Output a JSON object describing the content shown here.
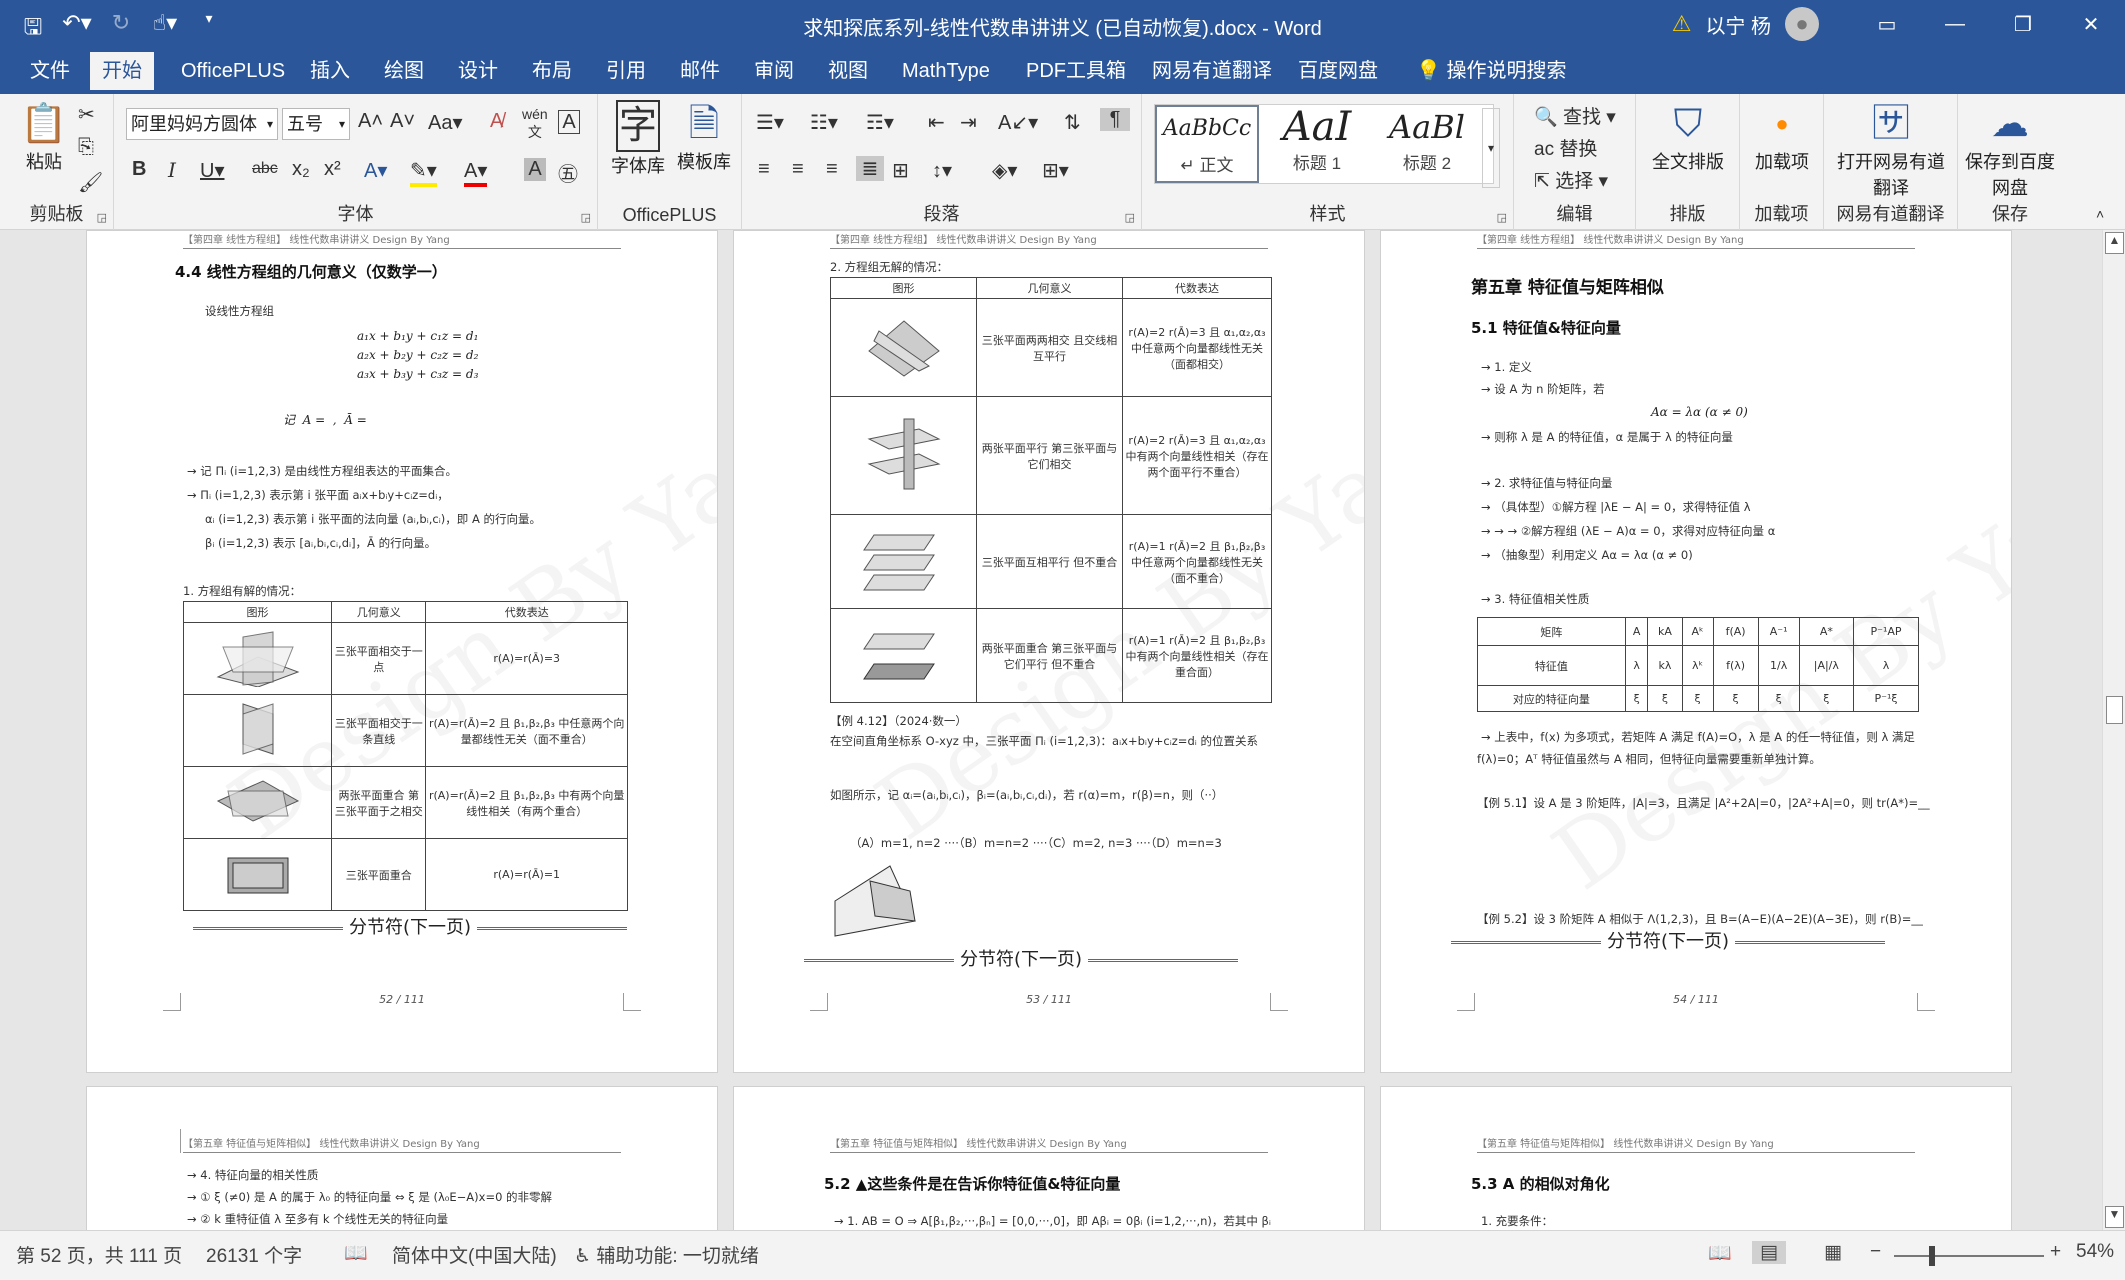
{
  "window": {
    "title": "求知探底系列-线性代数串讲讲义 (已自动恢复).docx  -  Word",
    "user": "以宁 杨"
  },
  "tabs": [
    "文件",
    "开始",
    "OfficePLUS",
    "插入",
    "绘图",
    "设计",
    "布局",
    "引用",
    "邮件",
    "审阅",
    "视图",
    "MathType",
    "PDF工具箱",
    "网易有道翻译",
    "百度网盘",
    "操作说明搜索"
  ],
  "ribbon": {
    "clipboard": {
      "label": "剪贴板",
      "paste": "粘贴"
    },
    "font": {
      "label": "字体",
      "font_name": "阿里妈妈方圆体",
      "font_size": "五号"
    },
    "officeplus": {
      "label": "OfficePLUS",
      "lib": "字体库",
      "template": "模板库"
    },
    "paragraph": {
      "label": "段落"
    },
    "styles": {
      "label": "样式",
      "items": [
        {
          "sample": "AaBbCc",
          "name": "↵ 正文"
        },
        {
          "sample": "AaI",
          "name": "标题 1"
        },
        {
          "sample": "AaBl",
          "name": "标题 2"
        }
      ]
    },
    "edit": {
      "label": "编辑",
      "find": "查找",
      "replace": "替换",
      "select": "选择"
    },
    "layout": {
      "label": "排版",
      "fulltext": "全文排版"
    },
    "addin": {
      "label": "加载项",
      "load": "加载项"
    },
    "youdao": {
      "label": "网易有道翻译",
      "open": "打开网易有道翻译"
    },
    "baidu": {
      "label": "保存",
      "save": "保存到百度网盘"
    }
  },
  "pages": {
    "p52": {
      "heading": "4.4 线性方程组的几何意义（仅数学一）",
      "intro": "设线性方程组",
      "eq1": "a₁x + b₁y + c₁z = d₁",
      "eq2": "a₂x + b₂y + c₂z = d₂",
      "eq3": "a₃x + b₃y + c₃z = d₃",
      "matrix_line": "记  A =  ,  Ā =",
      "bullet1": "→ 记 Πᵢ (i=1,2,3) 是由线性方程组表达的平面集合。",
      "bullet2": "→ Πᵢ (i=1,2,3) 表示第 i 张平面 aᵢx+bᵢy+cᵢz=dᵢ，",
      "bullet3": "αᵢ (i=1,2,3) 表示第 i 张平面的法向量 (aᵢ,bᵢ,cᵢ)，即 A 的行向量。",
      "bullet4": "βᵢ (i=1,2,3) 表示 [aᵢ,bᵢ,cᵢ,dᵢ]，Ā 的行向量。",
      "case_title": "1. 方程组有解的情况：",
      "table_head": [
        "图形",
        "几何意义",
        "代数表达"
      ],
      "rows": [
        {
          "geom": "三张平面相交于一点",
          "alg": "r(A)=r(Ā)=3"
        },
        {
          "geom": "三张平面相交于一条直线",
          "alg": "r(A)=r(Ā)=2 且 β₁,β₂,β₃ 中任意两个向量都线性无关（面不重合）"
        },
        {
          "geom": "两张平面重合 第三张平面于之相交",
          "alg": "r(A)=r(Ā)=2 且 β₁,β₂,β₃ 中有两个向量线性相关（有两个重合）"
        },
        {
          "geom": "三张平面重合",
          "alg": "r(A)=r(Ā)=1"
        }
      ],
      "section_break": "分节符(下一页)",
      "page_no": "52 / 111"
    },
    "p53": {
      "case_title": "2. 方程组无解的情况：",
      "table_head": [
        "图形",
        "几何意义",
        "代数表达"
      ],
      "rows": [
        {
          "geom": "三张平面两两相交 且交线相互平行",
          "alg": "r(A)=2  r(Ā)=3  且 α₁,α₂,α₃ 中任意两个向量都线性无关（面都相交）"
        },
        {
          "geom": "两张平面平行 第三张平面与它们相交",
          "alg": "r(A)=2  r(Ā)=3  且 α₁,α₂,α₃ 中有两个向量线性相关（存在两个面平行不重合）"
        },
        {
          "geom": "三张平面互相平行 但不重合",
          "alg": "r(A)=1  r(Ā)=2  且 β₁,β₂,β₃ 中任意两个向量都线性无关（面不重合）"
        },
        {
          "geom": "两张平面重合 第三张平面与它们平行 但不重合",
          "alg": "r(A)=1  r(Ā)=2  且 β₁,β₂,β₃ 中有两个向量线性相关（存在重合面）"
        }
      ],
      "example": "【例 4.12】（2024·数一）",
      "example_text": "在空间直角坐标系 O-xyz 中，三张平面 Πᵢ (i=1,2,3)：aᵢx+bᵢy+cᵢz=dᵢ 的位置关系",
      "example_text2": "如图所示，记 αᵢ=(aᵢ,bᵢ,cᵢ)，βᵢ=(aᵢ,bᵢ,cᵢ,dᵢ)，若 r(α)=m，r(β)=n，则（··）",
      "options": "（A）m=1, n=2 ····（B）m=n=2 ····（C）m=2, n=3 ····（D）m=n=3",
      "section_break": "分节符(下一页)",
      "page_no": "53 / 111"
    },
    "p54": {
      "chapter": "第五章  特征值与矩阵相似",
      "heading": "5.1 特征值&特征向量",
      "l1": "→ 1. 定义",
      "l2": "→ 设 A 为 n 阶矩阵，若",
      "eq": "Aα = λα (α ≠ 0)",
      "l3": "→ 则称 λ 是 A 的特征值，α 是属于 λ 的特征向量",
      "l4": "→ 2. 求特征值与特征向量",
      "l5": "→ （具体型）①解方程 |λE − A| = 0，求得特征值 λ",
      "l6": "→  →  → ②解方程组 (λE − A)α = 0，求得对应特征向量 α",
      "l7": "→ （抽象型）利用定义 Aα = λα (α ≠ 0)",
      "l8": "→ 3. 特征值相关性质",
      "table_head": [
        "矩阵",
        "A",
        "kA",
        "Aᵏ",
        "f(A)",
        "A⁻¹",
        "A*",
        "P⁻¹AP"
      ],
      "table_row1": [
        "特征值",
        "λ",
        "kλ",
        "λᵏ",
        "f(λ)",
        "1/λ",
        "|A|/λ",
        "λ"
      ],
      "table_row2": [
        "对应的特征向量",
        "ξ",
        "ξ",
        "ξ",
        "ξ",
        "ξ",
        "ξ",
        "P⁻¹ξ"
      ],
      "l9": "→ 上表中，f(x) 为多项式，若矩阵 A 满足 f(A)=O，λ 是 A 的任一特征值，则 λ 满足",
      "l10": "f(λ)=0；Aᵀ 特征值虽然与 A 相同，但特征向量需要重新单独计算。",
      "ex1": "【例 5.1】设 A 是 3 阶矩阵，|A|=3，且满足 |A²+2A|=0，|2A²+A|=0，则 tr(A*)=__",
      "ex2": "【例 5.2】设 3 阶矩阵 A 相似于 Λ(1,2,3)，且 B=(A−E)(A−2E)(A−3E)，则 r(B)=__",
      "section_break": "分节符(下一页)",
      "page_no": "54 / 111"
    },
    "p55": {
      "header": "【第五章  特征值与矩阵相似】        线性代数串讲讲义        Design By Yang",
      "l1": "→ 4. 特征向量的相关性质",
      "l2": "→ ① ξ (≠0) 是 A 的属于 λ₀ 的特征向量 ⇔ ξ 是 (λ₀E−A)x=0 的非零解",
      "l3": "→ ② k 重特征值 λ 至多有 k 个线性无关的特征向量"
    },
    "p56": {
      "header": "【第五章  特征值与矩阵相似】        线性代数串讲讲义        Design By Yang",
      "heading": "5.2 ▲这些条件是在告诉你特征值&特征向量",
      "l1": "→ 1. AB = O ⇒ A[β₁,β₂,···,βₙ] = [0,0,···,0]，即 Aβᵢ = 0βᵢ (i=1,2,···,n)，若其中 βᵢ"
    },
    "p57": {
      "header": "【第五章  特征值与矩阵相似】        线性代数串讲讲义        Design By Yang",
      "heading": "5.3 A 的相似对角化",
      "l1": "1. 充要条件："
    },
    "header_text": "【第四章  线性方程组】        线性代数串讲讲义        Design By Yang",
    "watermark": "Design By Yang"
  },
  "status": {
    "page": "第 52 页，共 111 页",
    "words": "26131 个字",
    "lang": "简体中文(中国大陆)",
    "access": "辅助功能: 一切就绪",
    "zoom": "54%"
  }
}
